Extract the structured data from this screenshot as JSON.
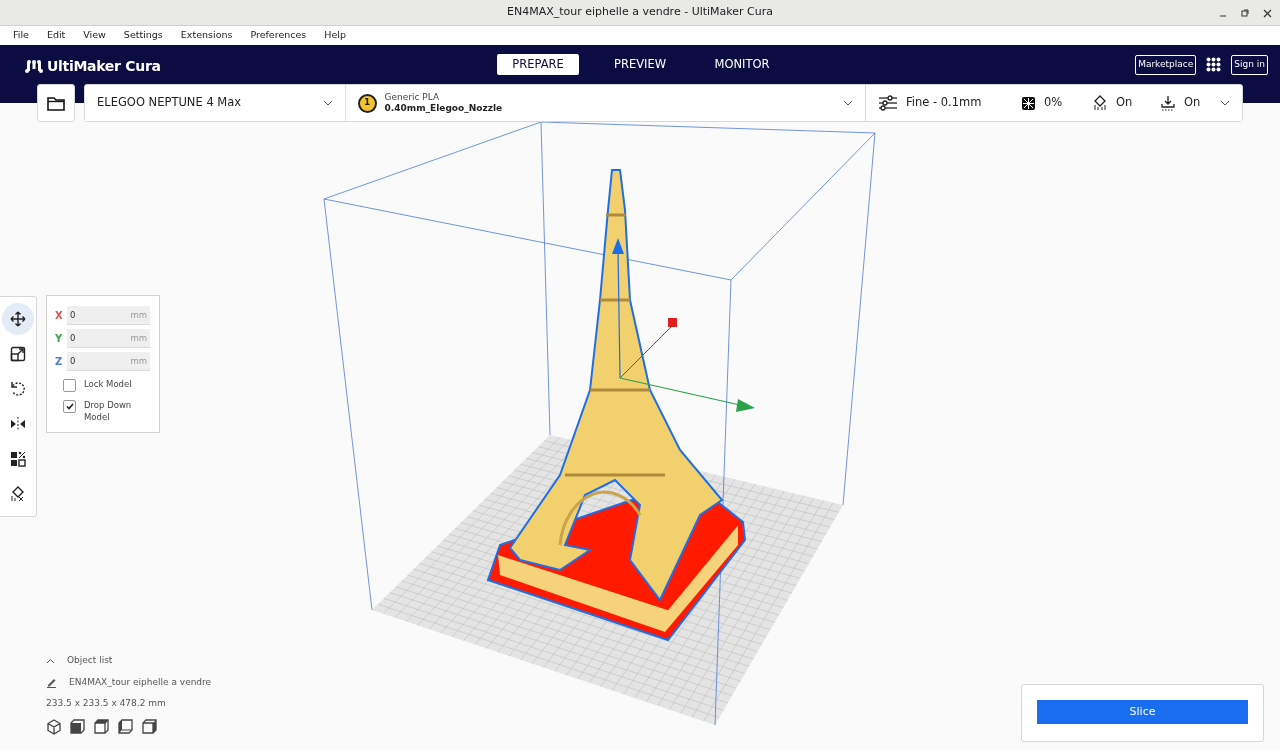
{
  "window": {
    "title": "EN4MAX_tour eiphelle a vendre - UltiMaker Cura"
  },
  "menu": [
    "File",
    "Edit",
    "View",
    "Settings",
    "Extensions",
    "Preferences",
    "Help"
  ],
  "header": {
    "logo": "UltiMaker Cura",
    "tabs": [
      {
        "label": "PREPARE",
        "selected": true
      },
      {
        "label": "PREVIEW",
        "selected": false
      },
      {
        "label": "MONITOR",
        "selected": false
      }
    ],
    "marketplace": "Marketplace",
    "sign_in": "Sign in"
  },
  "toolbar": {
    "printer": "ELEGOO NEPTUNE 4 Max",
    "extruder": "1",
    "material": "Generic PLA",
    "nozzle": "0.40mm_Elegoo_Nozzle",
    "profile": "Fine - 0.1mm",
    "infill": "0%",
    "support": "On",
    "adhesion": "On"
  },
  "tools": [
    {
      "kind": "move",
      "selected": true
    },
    {
      "kind": "scale",
      "selected": false
    },
    {
      "kind": "rotate",
      "selected": false
    },
    {
      "kind": "mirror",
      "selected": false
    },
    {
      "kind": "per-model",
      "selected": false
    },
    {
      "kind": "support-blocker",
      "selected": false
    }
  ],
  "move_panel": {
    "fields": [
      {
        "axis": "X",
        "value": "0",
        "unit": "mm",
        "color": "#d9534f"
      },
      {
        "axis": "Y",
        "value": "0",
        "unit": "mm",
        "color": "#3aa655"
      },
      {
        "axis": "Z",
        "value": "0",
        "unit": "mm",
        "color": "#4a7fd6"
      }
    ],
    "options": [
      {
        "label": "Lock Model",
        "checked": false
      },
      {
        "label": "Drop Down Model",
        "checked": true
      }
    ]
  },
  "object_list": {
    "title": "Object list",
    "name": "EN4MAX_tour eiphelle a vendre",
    "dimensions": "233.5 x 233.5 x 478.2 mm"
  },
  "views": [
    {
      "kind": "perspective"
    },
    {
      "kind": "front"
    },
    {
      "kind": "top"
    },
    {
      "kind": "left"
    },
    {
      "kind": "right"
    }
  ],
  "slice": {
    "label": "Slice"
  }
}
